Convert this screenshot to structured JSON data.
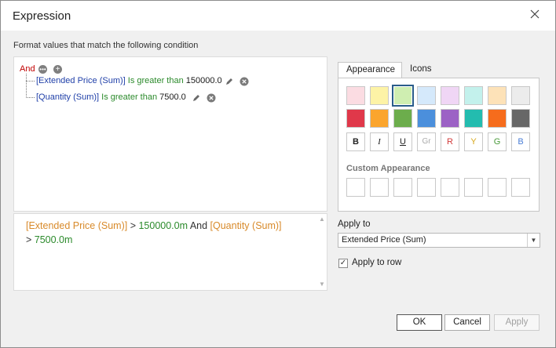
{
  "window": {
    "title": "Expression"
  },
  "condition_label": "Format values that match the following condition",
  "tree": {
    "root_operator": "And",
    "rows": [
      {
        "field": "[Extended Price (Sum)]",
        "operator": "Is greater than",
        "value": "150000.0"
      },
      {
        "field": "[Quantity (Sum)]",
        "operator": "Is greater than",
        "value": "7500.0"
      }
    ]
  },
  "expression": {
    "part1_field": "[Extended Price (Sum)]",
    "part1_op": " > ",
    "part1_val": "150000.0m",
    "joiner": " And ",
    "part2_field": "[Quantity (Sum)]",
    "part2_op": "> ",
    "part2_val": "7500.0m"
  },
  "tabs": {
    "appearance": "Appearance",
    "icons": "Icons"
  },
  "swatches": {
    "light": [
      "#fbdce2",
      "#fdf3a6",
      "#cfeeb1",
      "#d5e9fb",
      "#f0d6f5",
      "#c3f1ec",
      "#fde2b8",
      "#ececec"
    ],
    "dark": [
      "#e0384a",
      "#fba52d",
      "#6cad4c",
      "#4b8fdc",
      "#9c62c5",
      "#23bcaf",
      "#f66c1c",
      "#676767"
    ],
    "selected_index": 2
  },
  "format_buttons": {
    "bold": "B",
    "italic": "I",
    "underline": "U",
    "gray": "Gr",
    "red": "R",
    "yellow": "Y",
    "green": "G",
    "blue": "B"
  },
  "format_colors": {
    "gray": "#aaaaaa",
    "red": "#d23a3a",
    "yellow": "#d8a81c",
    "green": "#4a9a3a",
    "blue": "#4a7ed6"
  },
  "custom_appearance_label": "Custom Appearance",
  "apply_to": {
    "label": "Apply to",
    "selected": "Extended Price (Sum)",
    "apply_to_row_label": "Apply to row",
    "apply_to_row_checked": true
  },
  "buttons": {
    "ok": "OK",
    "cancel": "Cancel",
    "apply": "Apply"
  }
}
